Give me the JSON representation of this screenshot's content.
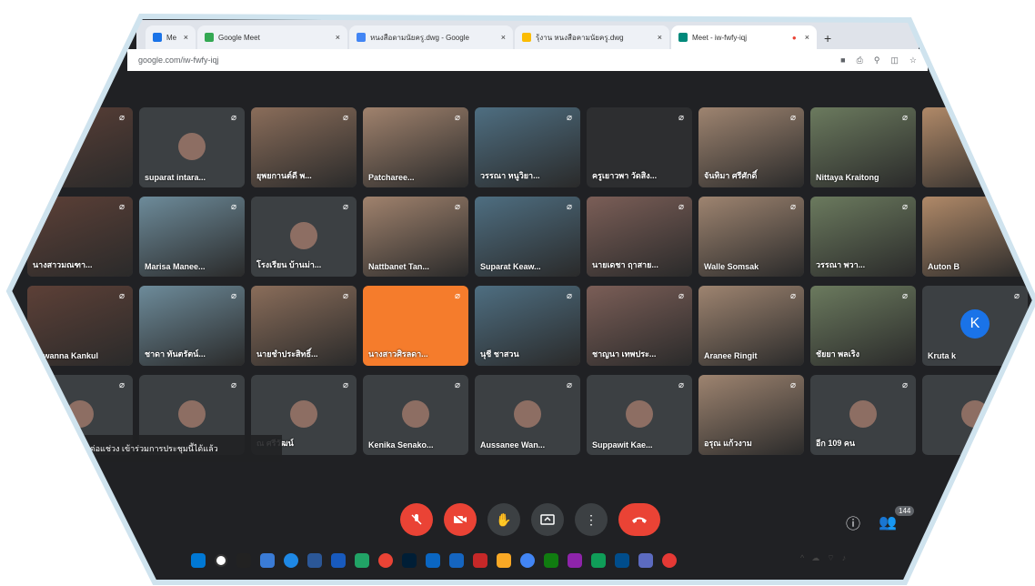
{
  "browser": {
    "tabs": [
      {
        "label": "Me",
        "active": false
      },
      {
        "label": "Google Meet",
        "active": false
      },
      {
        "label": "หนงสือดามนัยครู.dwg - Google",
        "active": false
      },
      {
        "label": "รุ้งาน หนงสือคามนัยครู.dwg",
        "active": false
      },
      {
        "label": "Meet - iw-fwfy-iqj",
        "active": true
      }
    ],
    "new_tab_label": "+",
    "url": "google.com/iw-fwfy-iqj"
  },
  "participants": [
    {
      "name": "",
      "row": 0,
      "col": 0,
      "style": "photo"
    },
    {
      "name": "suparat intara...",
      "row": 0,
      "col": 1,
      "style": "avatar"
    },
    {
      "name": "ยุพยกานต์ดี พ...",
      "row": 0,
      "col": 2,
      "style": "photo"
    },
    {
      "name": "Patcharee...",
      "row": 0,
      "col": 3,
      "style": "photo"
    },
    {
      "name": "วรรณา หนูวิยา...",
      "row": 0,
      "col": 4,
      "style": "photo"
    },
    {
      "name": "ครูเยาวพา วัดสิง...",
      "row": 0,
      "col": 5,
      "style": "dark"
    },
    {
      "name": "จันทิมา ศรีศักดิ์",
      "row": 0,
      "col": 6,
      "style": "photo"
    },
    {
      "name": "Nittaya Kraitong",
      "row": 0,
      "col": 7,
      "style": "photo"
    },
    {
      "name": "",
      "row": 0,
      "col": 8,
      "style": "photo"
    },
    {
      "name": "นางสาวมณฑา...",
      "row": 1,
      "col": 0,
      "style": "photo"
    },
    {
      "name": "Marisa Manee...",
      "row": 1,
      "col": 1,
      "style": "photo"
    },
    {
      "name": "โรงเรียน บ้านม่า...",
      "row": 1,
      "col": 2,
      "style": "avatar"
    },
    {
      "name": "Nattbanet Tan...",
      "row": 1,
      "col": 3,
      "style": "photo"
    },
    {
      "name": "Suparat Keaw...",
      "row": 1,
      "col": 4,
      "style": "photo"
    },
    {
      "name": "นายเดชา ฤาสาย...",
      "row": 1,
      "col": 5,
      "style": "photo"
    },
    {
      "name": "Walle Somsak",
      "row": 1,
      "col": 6,
      "style": "photo"
    },
    {
      "name": "วรรณา พวา...",
      "row": 1,
      "col": 7,
      "style": "photo"
    },
    {
      "name": "Auton B",
      "row": 1,
      "col": 8,
      "style": "photo"
    },
    {
      "name": "Suwanna Kankul",
      "row": 2,
      "col": 0,
      "style": "photo"
    },
    {
      "name": "ชาดา ทันตรัตน์...",
      "row": 2,
      "col": 1,
      "style": "photo"
    },
    {
      "name": "นายชำประสิทธิ์...",
      "row": 2,
      "col": 2,
      "style": "photo"
    },
    {
      "name": "นางสาวศิรลดา...",
      "row": 2,
      "col": 3,
      "style": "orange"
    },
    {
      "name": "นุชี ชาสวน",
      "row": 2,
      "col": 4,
      "style": "photo"
    },
    {
      "name": "ชาญนา เทพประ...",
      "row": 2,
      "col": 5,
      "style": "photo"
    },
    {
      "name": "Aranee Ringit",
      "row": 2,
      "col": 6,
      "style": "photo"
    },
    {
      "name": "ชัยยา พลเริง",
      "row": 2,
      "col": 7,
      "style": "photo"
    },
    {
      "name": "Kruta k",
      "row": 2,
      "col": 8,
      "style": "letter",
      "letter": "K"
    },
    {
      "name": "",
      "row": 3,
      "col": 0,
      "style": "avatar"
    },
    {
      "name": "",
      "row": 3,
      "col": 1,
      "style": "avatar"
    },
    {
      "name": "ณ ศรีวัฒน์",
      "row": 3,
      "col": 2,
      "style": "avatar"
    },
    {
      "name": "Kenika Senako...",
      "row": 3,
      "col": 3,
      "style": "avatar"
    },
    {
      "name": "Aussanee Wan...",
      "row": 3,
      "col": 4,
      "style": "avatar"
    },
    {
      "name": "Suppawit Kae...",
      "row": 3,
      "col": 5,
      "style": "avatar"
    },
    {
      "name": "อรุณ แก้วงาม",
      "row": 3,
      "col": 6,
      "style": "photo"
    },
    {
      "name": "อีก 109 คน",
      "row": 3,
      "col": 7,
      "style": "avatar"
    },
    {
      "name": "",
      "row": 3,
      "col": 8,
      "style": "avatar"
    }
  ],
  "caption": "ศิลา ต่อแช่วง เข้าร่วมการประชุมนี้ได้แล้ว",
  "meeting_code": "iqj",
  "controls": {
    "mic": "mic-off",
    "camera": "camera-off",
    "raise_hand": "hand",
    "present": "present",
    "more": "⋮",
    "end": "end-call"
  },
  "people_count": "144",
  "colors": {
    "meet_bg": "#202124",
    "tile_bg": "#3c4043",
    "red": "#ea4335",
    "orange_tile": "#f57c2c",
    "avatar_blue": "#1a73e8"
  }
}
